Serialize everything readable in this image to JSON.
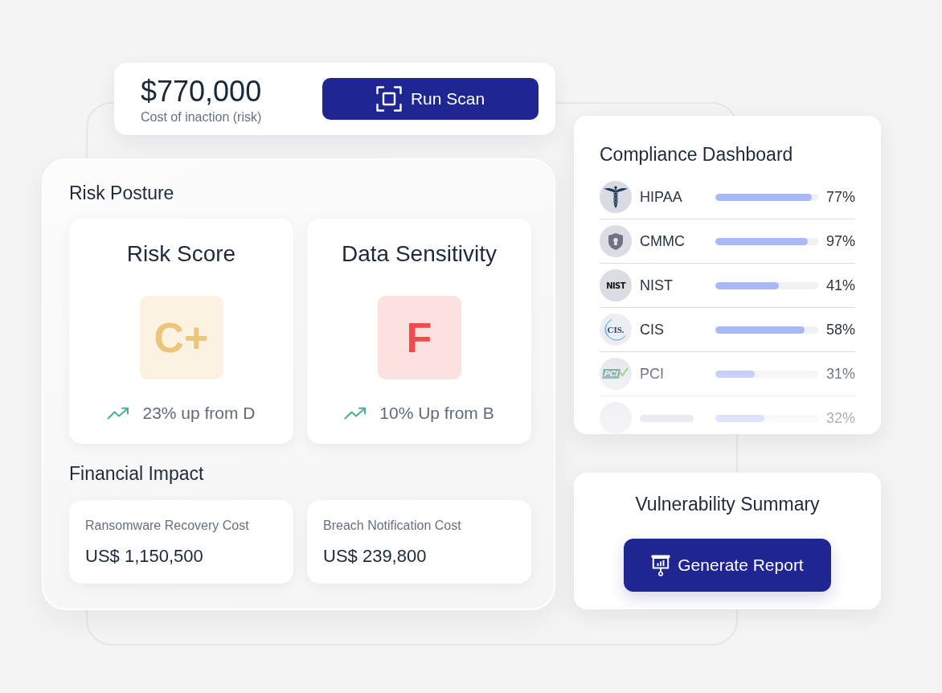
{
  "summary_card": {
    "amount": "$770,000",
    "caption": "Cost of inaction (risk)",
    "button": "Run Scan"
  },
  "risk_posture": {
    "title": "Risk Posture",
    "cards": [
      {
        "title": "Risk Score",
        "grade": "C+",
        "color": "#ecc47c",
        "trend": "23% up from D"
      },
      {
        "title": "Data Sensitivity",
        "grade": "F",
        "color": "#f24a4c",
        "trend": "10% Up from B"
      }
    ]
  },
  "financial_impact": {
    "title": "Financial Impact",
    "cards": [
      {
        "label": "Ransomware Recovery Cost",
        "value": "US$ 1,150,500"
      },
      {
        "label": "Breach Notification Cost",
        "value": "US$ 239,800"
      }
    ]
  },
  "compliance_dashboard": {
    "title": "Compliance Dashboard",
    "rows": [
      {
        "kind": "caduceus",
        "name": "HIPAA",
        "level": 0.94,
        "reading": "77%"
      },
      {
        "kind": "shield",
        "name": "CMMC",
        "level": 0.9,
        "reading": "97%"
      },
      {
        "kind": "nist",
        "logo_text": "NIST",
        "name": "NIST",
        "level": 0.62,
        "reading": "41%"
      },
      {
        "kind": "cis",
        "logo_text": "CIS.",
        "name": "CIS",
        "level": 0.87,
        "reading": "58%"
      },
      {
        "kind": "pci",
        "logo_text": "PCI",
        "name": "PCI",
        "level": 0.38,
        "reading": "31%"
      },
      {
        "kind": "blank",
        "level": 0.48,
        "reading": "32%"
      }
    ]
  },
  "vulnerability_summary": {
    "title": "Vulnerability Summary",
    "button": "Generate Report"
  }
}
